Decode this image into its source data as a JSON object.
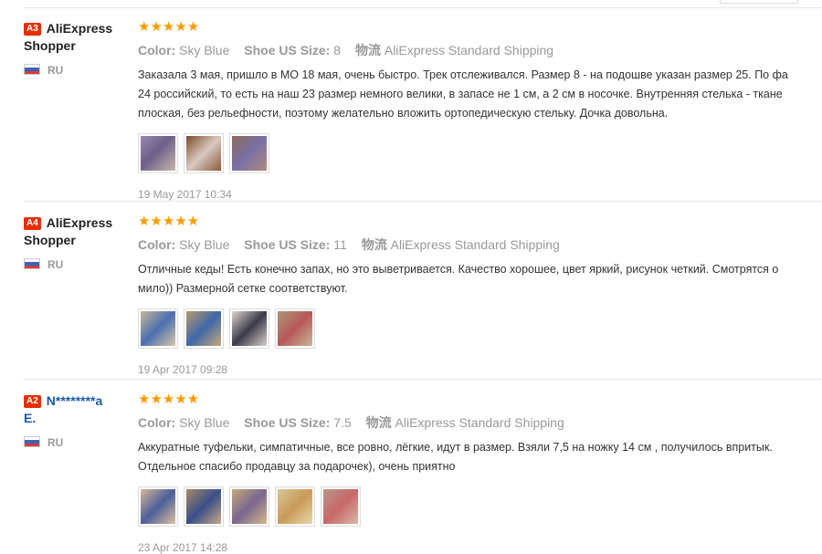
{
  "reviews": [
    {
      "badge": "A3",
      "user_line1": "AliExpress",
      "user_line2": "Shopper",
      "country": "RU",
      "stars": "★★★★★",
      "color_label": "Color:",
      "color_value": "Sky Blue",
      "size_label": "Shoe US Size:",
      "size_value": "8",
      "ship_label": "物流",
      "ship_value": "AliExpress Standard Shipping",
      "text_line1": "Заказала 3 мая, пришло в МО 18 мая, очень быстро. Трек отслеживался. Размер 8 - на подошве указан размер 25. По фа",
      "text_line2": "24 российский, то есть на наш 23 размер немного велики, в запасе не 1 см, а 2 см в носочке. Внутренняя стелька - ткане",
      "text_line3": "плоская, без рельефности, поэтому желательно вложить ортопедическую стельку. Дочка довольна.",
      "date": "19 May 2017 10:34"
    },
    {
      "badge": "A4",
      "user_line1": "AliExpress",
      "user_line2": "Shopper",
      "country": "RU",
      "stars": "★★★★★",
      "color_label": "Color:",
      "color_value": "Sky Blue",
      "size_label": "Shoe US Size:",
      "size_value": "11",
      "ship_label": "物流",
      "ship_value": "AliExpress Standard Shipping",
      "text_line1": "Отличные кеды! Есть конечно запах, но это выветривается. Качество хорошее, цвет яркий, рисунок четкий. Смотрятся о",
      "text_line2": "мило)) Размерной сетке соответствуют.",
      "date": "19 Apr 2017 09:28"
    },
    {
      "badge": "A2",
      "user_line1": "N********a",
      "user_line2": "E.",
      "country": "RU",
      "stars": "★★★★★",
      "color_label": "Color:",
      "color_value": "Sky Blue",
      "size_label": "Shoe US Size:",
      "size_value": "7.5",
      "ship_label": "物流",
      "ship_value": "AliExpress Standard Shipping",
      "text_line1": "Аккуратные туфельки, симпатичные, все ровно, лёгкие, идут в размер. Взяли 7,5 на ножку 14 см , получилось впритык.",
      "text_line2": "Отдельное спасибо продавцу за подарочек), очень приятно",
      "date": "23 Apr 2017 14:28"
    }
  ],
  "colors": {
    "badge": "#e62e04",
    "stars": "#ff9a00",
    "masked_name": "#1a5aa8"
  }
}
